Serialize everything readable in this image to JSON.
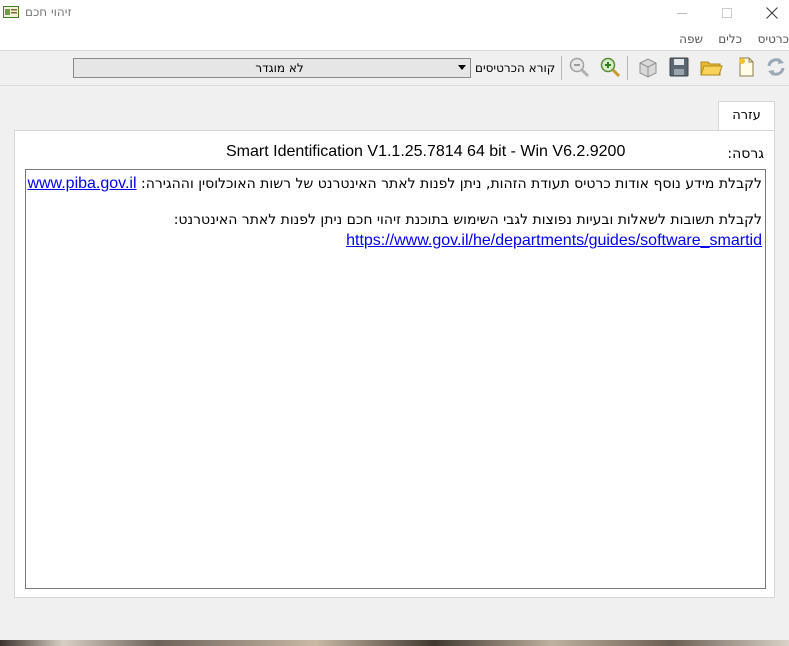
{
  "window": {
    "title": "זיהוי חכם",
    "icon": "id-card-icon",
    "controls": {
      "minimize": "minimize-icon",
      "maximize": "maximize-icon",
      "close": "close-icon"
    }
  },
  "menu": {
    "items": [
      {
        "label": "כרטיס"
      },
      {
        "label": "כלים"
      },
      {
        "label": "שפה"
      }
    ]
  },
  "toolbar": {
    "icons": [
      "refresh-icon",
      "new-document-icon",
      "open-folder-icon",
      "save-icon",
      "card-box-icon",
      "zoom-in-icon",
      "zoom-out-icon"
    ],
    "reader_label": "קורא הכרטיסים",
    "reader_value": "לא מוגדר"
  },
  "tabs": [
    {
      "label": "עזרה",
      "active": true
    }
  ],
  "help": {
    "version_label": "גרסה:",
    "version_value": "Smart Identification V1.1.25.7814 64 bit - Win V6.2.9200",
    "line1_text": "לקבלת מידע נוסף אודות כרטיס תעודת הזהות, ניתן לפנות לאתר האינטרנט של רשות האוכלוסין וההגירה: ",
    "line1_link": "www.piba.gov.il",
    "line2_text": "לקבלת תשובות לשאלות ובעיות נפוצות לגבי השימוש בתוכנת זיהוי חכם ניתן לפנות לאתר האינטרנט:",
    "line3_link": "https://www.gov.il/he/departments/guides/software_smartid"
  },
  "colors": {
    "link": "#0000ee",
    "window_bg": "#f0f0f0",
    "panel_bg": "#ffffff"
  }
}
